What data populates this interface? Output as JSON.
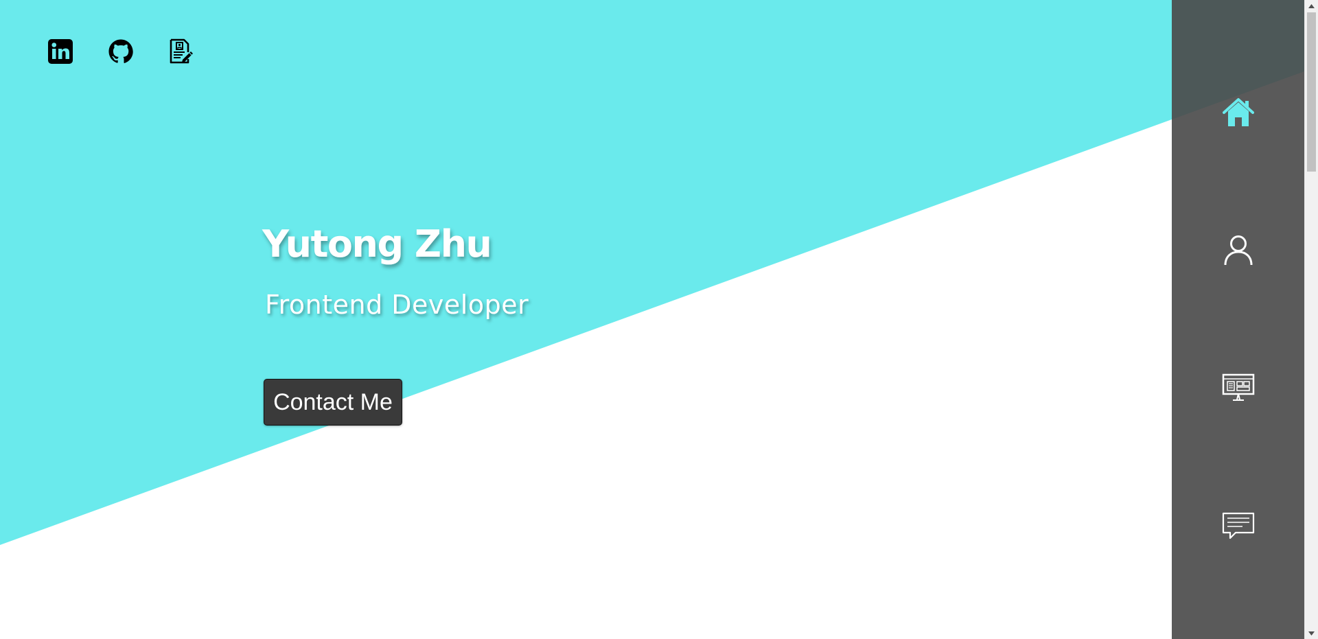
{
  "hero": {
    "name": "Yutong Zhu",
    "role": "Frontend Developer",
    "contact_label": "Contact Me"
  },
  "social": [
    {
      "icon": "linkedin-icon"
    },
    {
      "icon": "github-icon"
    },
    {
      "icon": "resume-icon"
    }
  ],
  "nav": [
    {
      "icon": "home-icon",
      "active": true
    },
    {
      "icon": "user-icon",
      "active": false
    },
    {
      "icon": "monitor-icon",
      "active": false
    },
    {
      "icon": "chat-icon",
      "active": false
    }
  ],
  "colors": {
    "accent": "#6aeaec",
    "sidebar": "#5a5a5a",
    "sidebar_top": "#4d5858",
    "button": "#3a3a3a",
    "icon_light": "#ffffff"
  },
  "scrollbar": {
    "position": 0
  }
}
